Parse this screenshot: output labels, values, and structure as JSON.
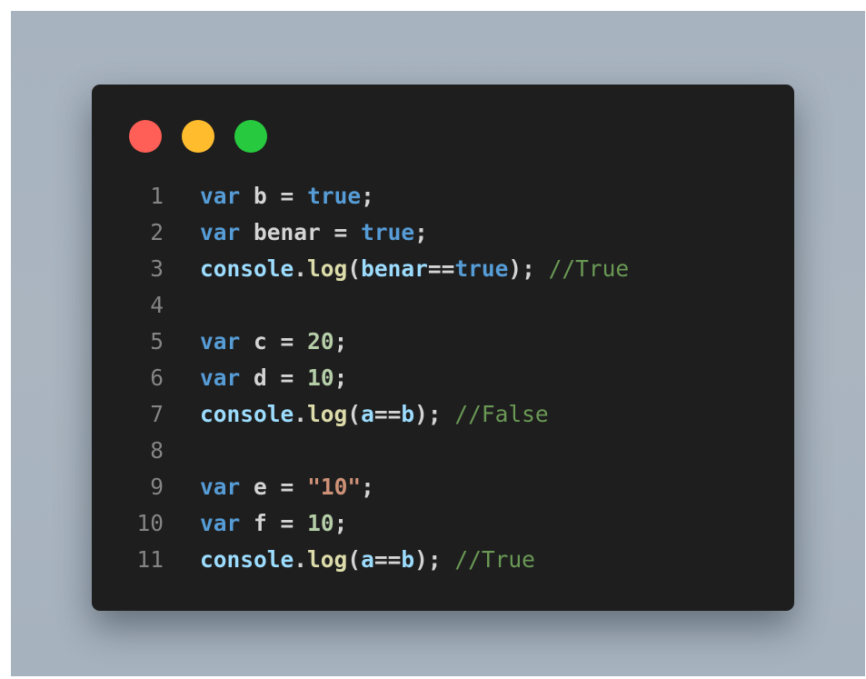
{
  "colors": {
    "background": "#a7b3bf",
    "editor_background": "#1e1e1e",
    "line_number": "#858585",
    "keyword": "#569cd6",
    "variable": "#9cdcfe",
    "plain": "#d4d4d4",
    "number": "#b5cea8",
    "string": "#ce9178",
    "function": "#dcdcaa",
    "comment": "#6a9955"
  },
  "window": {
    "controls": [
      {
        "name": "close",
        "color": "#ff5f56"
      },
      {
        "name": "minimize",
        "color": "#ffbd2e"
      },
      {
        "name": "maximize",
        "color": "#27c93f"
      }
    ]
  },
  "code": {
    "lines": [
      {
        "number": "1",
        "tokens": [
          [
            "kw",
            "var"
          ],
          [
            "op",
            " "
          ],
          [
            "id",
            "b"
          ],
          [
            "op",
            " = "
          ],
          [
            "kw",
            "true"
          ],
          [
            "op",
            ";"
          ]
        ]
      },
      {
        "number": "2",
        "tokens": [
          [
            "kw",
            "var"
          ],
          [
            "op",
            " "
          ],
          [
            "id",
            "benar"
          ],
          [
            "op",
            " = "
          ],
          [
            "kw",
            "true"
          ],
          [
            "op",
            ";"
          ]
        ]
      },
      {
        "number": "3",
        "tokens": [
          [
            "var",
            "console"
          ],
          [
            "op",
            "."
          ],
          [
            "fn",
            "log"
          ],
          [
            "op",
            "("
          ],
          [
            "var",
            "benar"
          ],
          [
            "op",
            "=="
          ],
          [
            "kw",
            "true"
          ],
          [
            "op",
            "); "
          ],
          [
            "cmt",
            "//True"
          ]
        ]
      },
      {
        "number": "4",
        "tokens": []
      },
      {
        "number": "5",
        "tokens": [
          [
            "kw",
            "var"
          ],
          [
            "op",
            " "
          ],
          [
            "id",
            "c"
          ],
          [
            "op",
            " = "
          ],
          [
            "num",
            "20"
          ],
          [
            "op",
            ";"
          ]
        ]
      },
      {
        "number": "6",
        "tokens": [
          [
            "kw",
            "var"
          ],
          [
            "op",
            " "
          ],
          [
            "id",
            "d"
          ],
          [
            "op",
            " = "
          ],
          [
            "num",
            "10"
          ],
          [
            "op",
            ";"
          ]
        ]
      },
      {
        "number": "7",
        "tokens": [
          [
            "var",
            "console"
          ],
          [
            "op",
            "."
          ],
          [
            "fn",
            "log"
          ],
          [
            "op",
            "("
          ],
          [
            "var",
            "a"
          ],
          [
            "op",
            "=="
          ],
          [
            "var",
            "b"
          ],
          [
            "op",
            "); "
          ],
          [
            "cmt",
            "//False"
          ]
        ]
      },
      {
        "number": "8",
        "tokens": []
      },
      {
        "number": "9",
        "tokens": [
          [
            "kw",
            "var"
          ],
          [
            "op",
            " "
          ],
          [
            "id",
            "e"
          ],
          [
            "op",
            " = "
          ],
          [
            "str",
            "\"10\""
          ],
          [
            "op",
            ";"
          ]
        ]
      },
      {
        "number": "10",
        "tokens": [
          [
            "kw",
            "var"
          ],
          [
            "op",
            " "
          ],
          [
            "id",
            "f"
          ],
          [
            "op",
            " = "
          ],
          [
            "num",
            "10"
          ],
          [
            "op",
            ";"
          ]
        ]
      },
      {
        "number": "11",
        "tokens": [
          [
            "var",
            "console"
          ],
          [
            "op",
            "."
          ],
          [
            "fn",
            "log"
          ],
          [
            "op",
            "("
          ],
          [
            "var",
            "a"
          ],
          [
            "op",
            "=="
          ],
          [
            "var",
            "b"
          ],
          [
            "op",
            "); "
          ],
          [
            "cmt",
            "//True"
          ]
        ]
      }
    ]
  }
}
